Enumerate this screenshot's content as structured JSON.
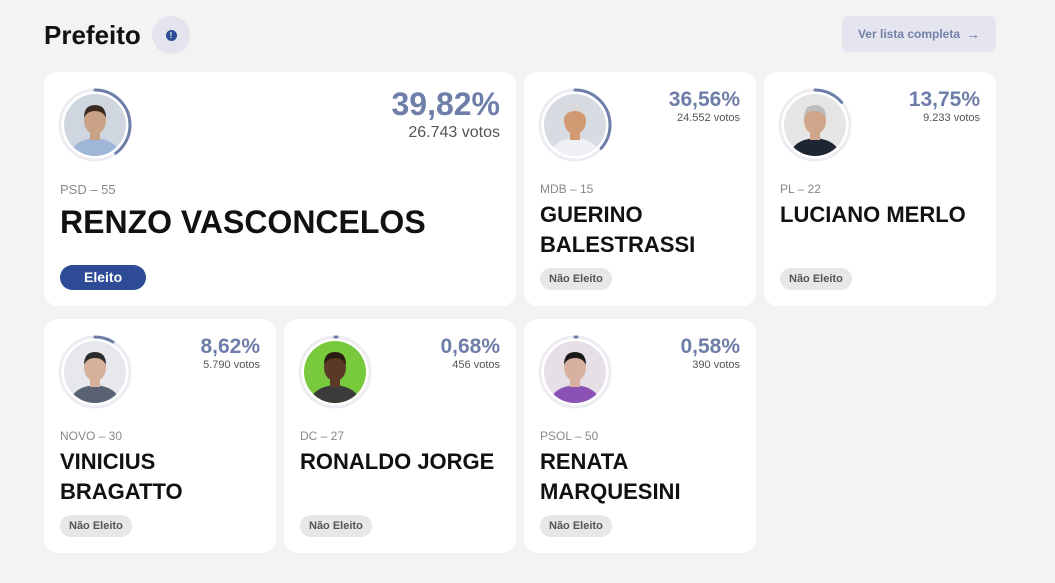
{
  "header": {
    "title": "Prefeito",
    "info_symbol": "!",
    "list_button_label": "Ver lista completa",
    "list_button_arrow": "→"
  },
  "candidates": [
    {
      "party": "PSD – 55",
      "name": "RENZO VASCONCELOS",
      "percent": "39,82%",
      "votes": "26.743 votos",
      "status": "Eleito",
      "share": 0.3982,
      "photo_bg": "#cfd6e0",
      "shirt": "#9fb6d8",
      "skin": "#c9a285",
      "hair": "#3a2b22"
    },
    {
      "party": "MDB – 15",
      "name": "GUERINO BALESTRASSI",
      "percent": "36,56%",
      "votes": "24.552 votos",
      "status": "Não Eleito",
      "share": 0.3656,
      "photo_bg": "#d7dbe2",
      "shirt": "#eef0f3",
      "skin": "#d19a72",
      "hair": "#d9d9d9"
    },
    {
      "party": "PL – 22",
      "name": "LUCIANO MERLO",
      "percent": "13,75%",
      "votes": "9.233 votos",
      "status": "Não Eleito",
      "share": 0.1375,
      "photo_bg": "#e5e5e5",
      "shirt": "#1f2433",
      "skin": "#cfa68a",
      "hair": "#bdbdbd"
    },
    {
      "party": "NOVO – 30",
      "name": "VINICIUS BRAGATTO",
      "percent": "8,62%",
      "votes": "5.790 votos",
      "status": "Não Eleito",
      "share": 0.0862,
      "photo_bg": "#e6e8ec",
      "shirt": "#596273",
      "skin": "#d6b09a",
      "hair": "#2b2b2b"
    },
    {
      "party": "DC – 27",
      "name": "RONALDO JORGE",
      "percent": "0,68%",
      "votes": "456 votos",
      "status": "Não Eleito",
      "share": 0.0068,
      "photo_bg": "#78c93b",
      "shirt": "#3b3b3b",
      "skin": "#5a3a26",
      "hair": "#2a1a12"
    },
    {
      "party": "PSOL – 50",
      "name": "RENATA MARQUESINI",
      "percent": "0,58%",
      "votes": "390 votos",
      "status": "Não Eleito",
      "share": 0.0058,
      "photo_bg": "#e7dfe6",
      "shirt": "#8a52b5",
      "skin": "#d8b0a0",
      "hair": "#1a1a1a"
    }
  ],
  "colors": {
    "accent": "#2e4c95",
    "percent": "#6e7ea8",
    "ring": "#6e7ea8",
    "ring_track": "#ececf2"
  }
}
